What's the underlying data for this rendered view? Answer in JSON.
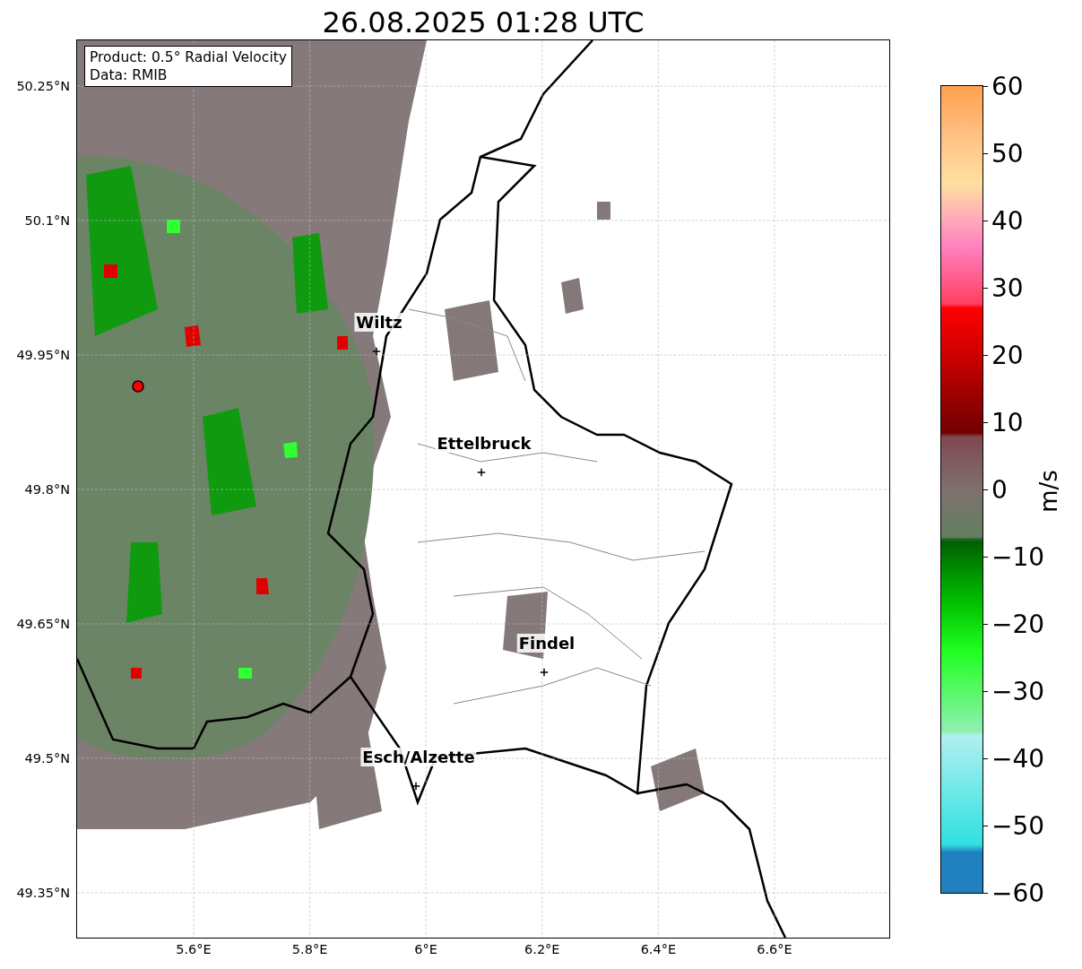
{
  "title": "26.08.2025 01:28 UTC",
  "map": {
    "info_box": [
      "Product: 0.5° Radial Velocity",
      "Data: RMIB"
    ],
    "places": [
      {
        "name": "Wiltz"
      },
      {
        "name": "Ettelbruck"
      },
      {
        "name": "Findel"
      },
      {
        "name": "Esch/Alzette"
      }
    ],
    "y_ticks": [
      "50.25°N",
      "50.1°N",
      "49.95°N",
      "49.8°N",
      "49.65°N",
      "49.5°N",
      "49.35°N"
    ],
    "x_ticks": [
      "5.6°E",
      "5.8°E",
      "6°E",
      "6.2°E",
      "6.4°E",
      "6.6°E"
    ]
  },
  "colorbar": {
    "label": "m/s",
    "ticks": [
      "60",
      "50",
      "40",
      "30",
      "20",
      "10",
      "0",
      "−10",
      "−20",
      "−30",
      "−40",
      "−50",
      "−60"
    ]
  }
}
